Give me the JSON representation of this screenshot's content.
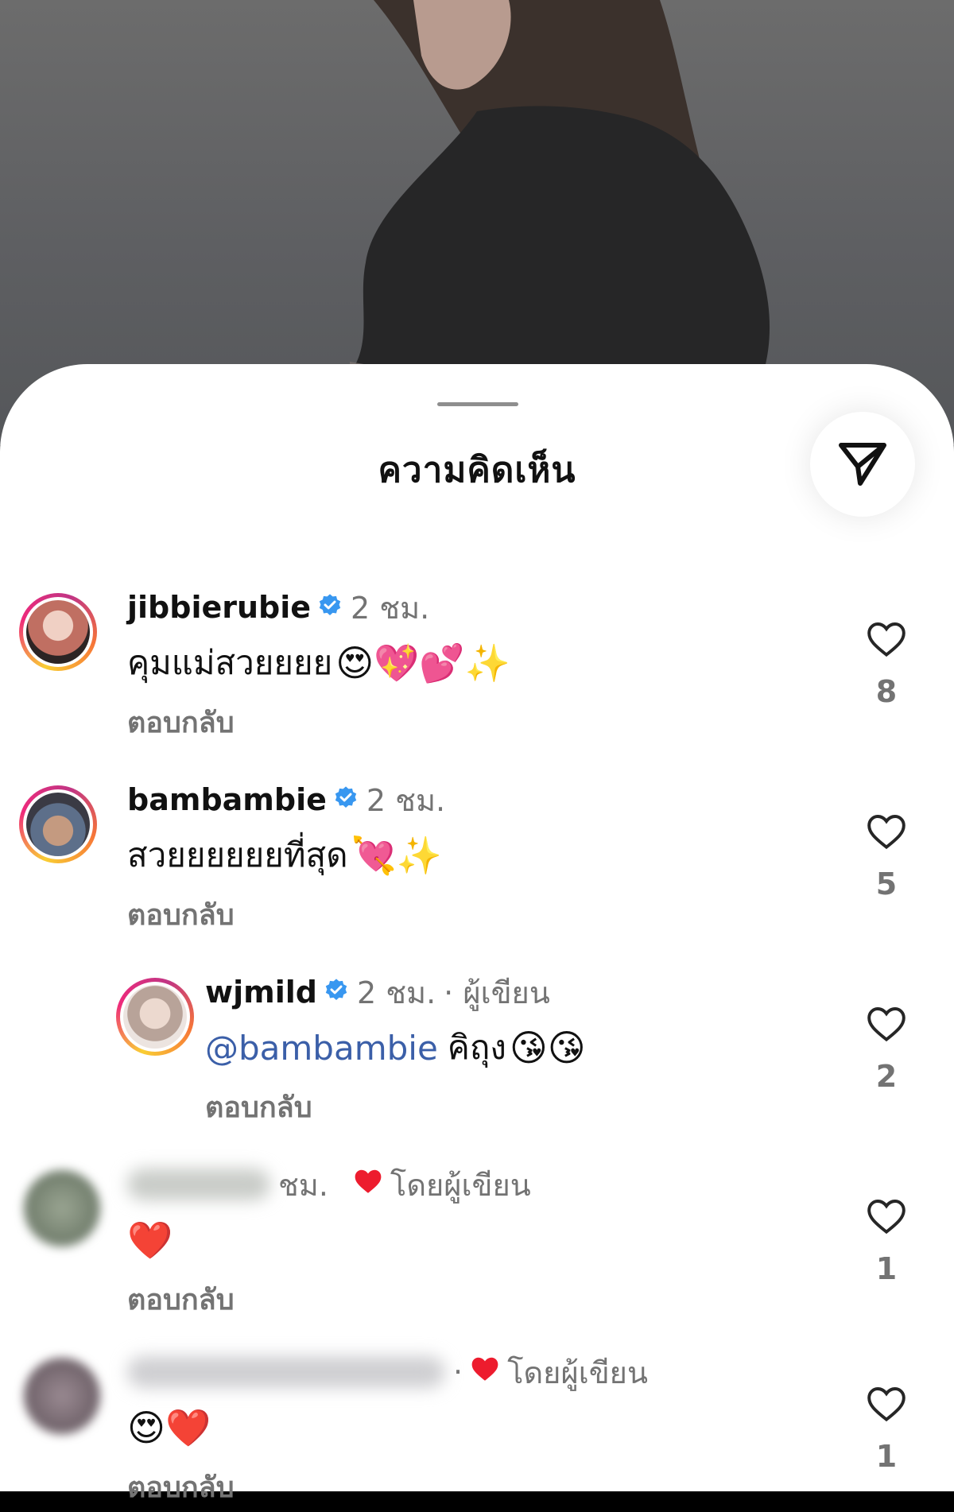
{
  "sheet": {
    "title": "ความคิดเห็น",
    "share_icon": "send-paper-plane-icon"
  },
  "comments": [
    {
      "username": "jibbierubie",
      "verified": true,
      "time": "2 ชม.",
      "text": "คุมแม่สวยยยย",
      "emojis": "😍💖💕✨",
      "reply_label": "ตอบกลับ",
      "likes": "8",
      "avatar_color": "#c98a82"
    },
    {
      "username": "bambambie",
      "verified": true,
      "time": "2 ชม.",
      "text": "สวยยยยยยที่สุด",
      "emojis": "💘✨",
      "reply_label": "ตอบกลับ",
      "likes": "5",
      "avatar_color": "#8d6d5b"
    },
    {
      "username": "wjmild",
      "verified": true,
      "time": "2 ชม.",
      "author_tag": "· ผู้เขียน",
      "mention": "@bambambie",
      "text": "คิถุง",
      "emojis": "😘😘",
      "reply_label": "ตอบกลับ",
      "likes": "2",
      "avatar_color": "#d8c6bd"
    },
    {
      "time_partial": "ชม.",
      "liked_by_author": "โดยผู้เขียน",
      "emojis": "❤️",
      "reply_label": "ตอบกลับ",
      "likes": "1",
      "avatar_color": "#7c8a77"
    },
    {
      "time_partial": "·",
      "liked_by_author": "โดยผู้เขียน",
      "emojis": "😍❤️",
      "reply_label": "ตอบกลับ",
      "likes": "1",
      "avatar_color": "#6f6269"
    }
  ],
  "colors": {
    "accent_mention": "#3b5fa8",
    "verified_blue": "#3897f0",
    "heart_red": "#ed1c2e",
    "muted_text": "#737373"
  }
}
